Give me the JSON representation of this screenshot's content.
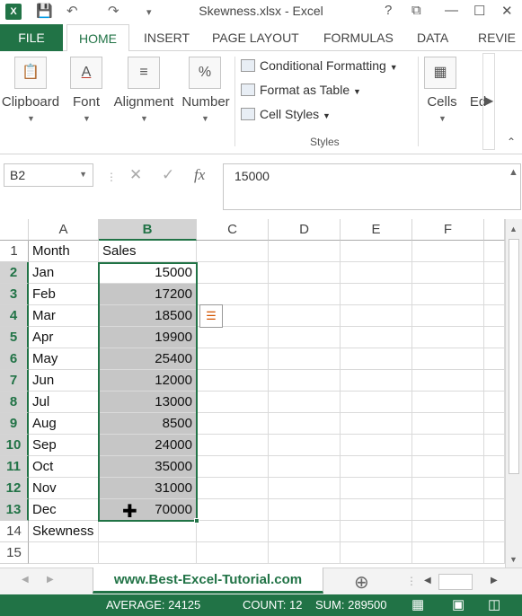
{
  "window": {
    "title": "Skewness.xlsx - Excel",
    "app_icon": "X",
    "help": "?",
    "undo": "↶",
    "redo": "↷",
    "restore": "⧉",
    "minimize": "—",
    "maximize": "☐",
    "close": "✕"
  },
  "ribbon_tabs": [
    "FILE",
    "HOME",
    "INSERT",
    "PAGE LAYOUT",
    "FORMULAS",
    "DATA",
    "REVIE"
  ],
  "ribbon": {
    "clipboard": "Clipboard",
    "font": "Font",
    "alignment": "Alignment",
    "number": "Number",
    "conditional_formatting": "Conditional Formatting",
    "format_as_table": "Format as Table",
    "cell_styles": "Cell Styles",
    "styles_group": "Styles",
    "cells": "Cells",
    "editing": "Ed"
  },
  "formula_bar": {
    "name_box": "B2",
    "formula": "15000",
    "fx": "fx"
  },
  "columns": [
    "A",
    "B",
    "C",
    "D",
    "E",
    "F"
  ],
  "rows": [
    {
      "n": "1",
      "a": "Month",
      "b": ""
    },
    {
      "n": "2",
      "a": "Jan",
      "b": "15000"
    },
    {
      "n": "3",
      "a": "Feb",
      "b": "17200"
    },
    {
      "n": "4",
      "a": "Mar",
      "b": "18500"
    },
    {
      "n": "5",
      "a": "Apr",
      "b": "19900"
    },
    {
      "n": "6",
      "a": "May",
      "b": "25400"
    },
    {
      "n": "7",
      "a": "Jun",
      "b": "12000"
    },
    {
      "n": "8",
      "a": "Jul",
      "b": "13000"
    },
    {
      "n": "9",
      "a": "Aug",
      "b": "8500"
    },
    {
      "n": "10",
      "a": "Sep",
      "b": "24000"
    },
    {
      "n": "11",
      "a": "Oct",
      "b": "35000"
    },
    {
      "n": "12",
      "a": "Nov",
      "b": "31000"
    },
    {
      "n": "13",
      "a": "Dec",
      "b": "70000"
    },
    {
      "n": "14",
      "a": "Skewness",
      "b": ""
    },
    {
      "n": "15",
      "a": "",
      "b": ""
    }
  ],
  "header_b1": "Sales",
  "sheet_tab": "www.Best-Excel-Tutorial.com",
  "status": {
    "average": "AVERAGE: 24125",
    "count": "COUNT: 12",
    "sum": "SUM: 289500"
  },
  "colors": {
    "accent": "#217346",
    "selection_fill": "#c6c6c6"
  }
}
